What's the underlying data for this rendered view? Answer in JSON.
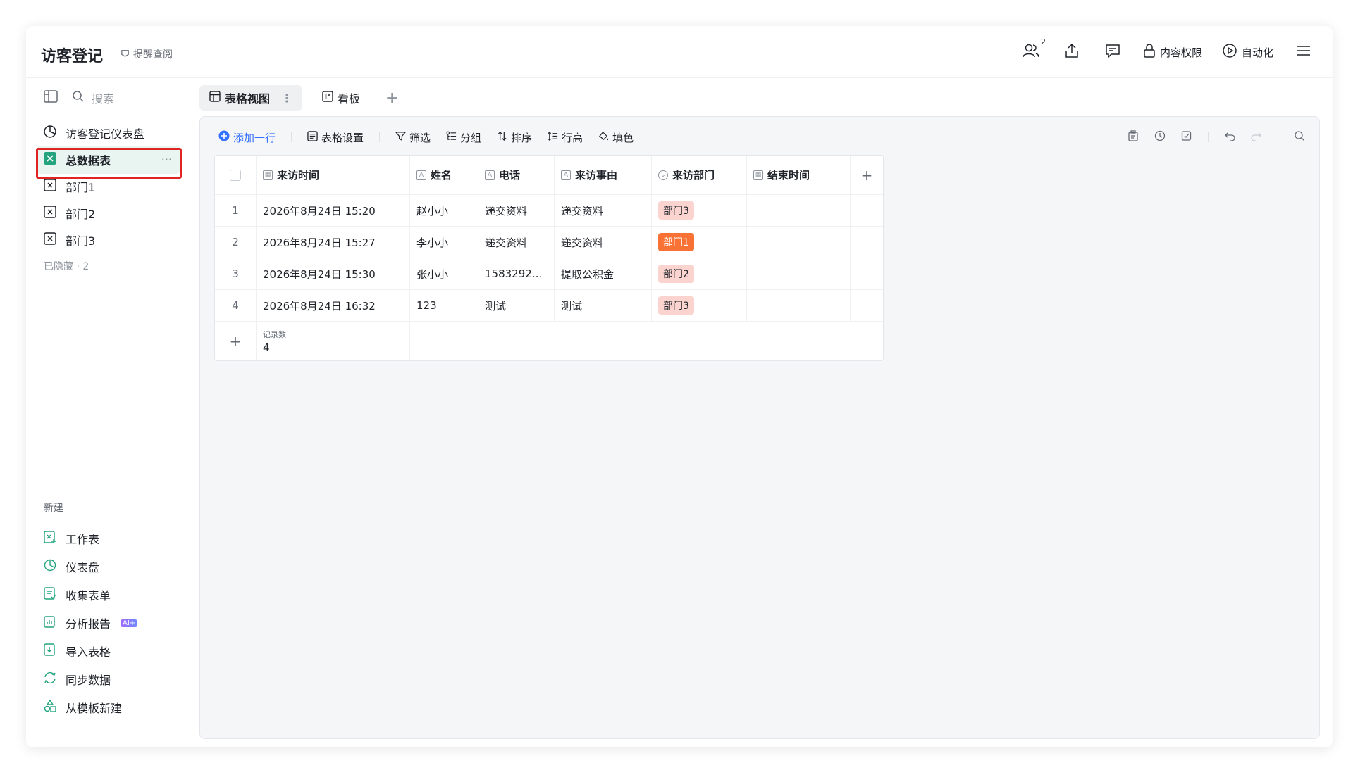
{
  "app": {
    "title": "访客登记",
    "remind_label": "提醒查阅"
  },
  "topbar": {
    "collab_count": "2",
    "permission_label": "内容权限",
    "automation_label": "自动化"
  },
  "sidebar": {
    "search_placeholder": "搜索",
    "items": [
      {
        "label": "访客登记仪表盘"
      },
      {
        "label": "总数据表"
      },
      {
        "label": "部门1"
      },
      {
        "label": "部门2"
      },
      {
        "label": "部门3"
      }
    ],
    "hidden_label": "已隐藏 · 2",
    "new_label": "新建",
    "new_items": [
      {
        "label": "工作表"
      },
      {
        "label": "仪表盘"
      },
      {
        "label": "收集表单"
      },
      {
        "label": "分析报告",
        "badge": "AI+"
      },
      {
        "label": "导入表格"
      },
      {
        "label": "同步数据"
      },
      {
        "label": "从模板新建"
      }
    ]
  },
  "tabs": [
    {
      "label": "表格视图"
    },
    {
      "label": "看板"
    }
  ],
  "toolbar": {
    "add_row": "添加一行",
    "table_settings": "表格设置",
    "filter": "筛选",
    "group": "分组",
    "sort": "排序",
    "row_height": "行高",
    "fill_color": "填色"
  },
  "table": {
    "columns": [
      "来访时间",
      "姓名",
      "电话",
      "来访事由",
      "来访部门",
      "结束时间"
    ],
    "rows": [
      {
        "index": "1",
        "time": "2026年8月24日 15:20",
        "name": "赵小小",
        "phone": "递交资料",
        "reason": "递交资料",
        "dept": "部门3",
        "end": ""
      },
      {
        "index": "2",
        "time": "2026年8月24日 15:27",
        "name": "李小小",
        "phone": "递交资料",
        "reason": "递交资料",
        "dept": "部门1",
        "end": ""
      },
      {
        "index": "3",
        "time": "2026年8月24日 15:30",
        "name": "张小小",
        "phone": "1583292...",
        "reason": "提取公积金",
        "dept": "部门2",
        "end": ""
      },
      {
        "index": "4",
        "time": "2026年8月24日 16:32",
        "name": "123",
        "phone": "测试",
        "reason": "测试",
        "dept": "部门3",
        "end": ""
      }
    ],
    "footer": {
      "count_label": "记录数",
      "count_value": "4"
    }
  },
  "colors": {
    "accent": "#3370ff",
    "active_nav_bg": "#e9f5f1",
    "dept1_tag": "#f77234",
    "dept_tag_light": "#fbd4d0",
    "highlight_outline": "#e02424"
  }
}
